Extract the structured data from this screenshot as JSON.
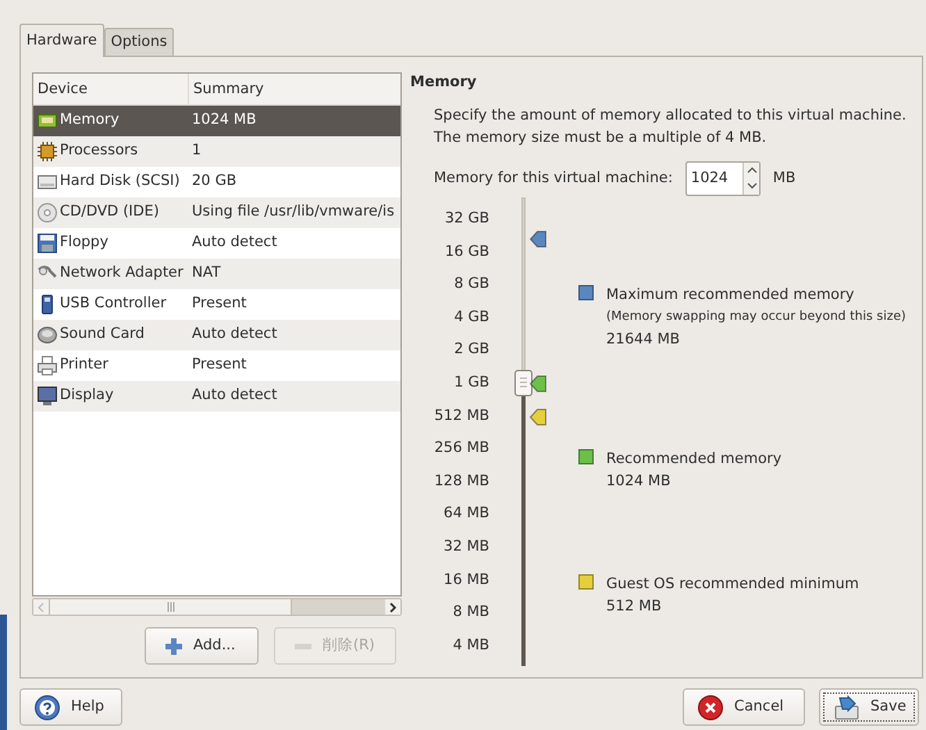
{
  "tabs": [
    {
      "label": "Hardware",
      "selected": true
    },
    {
      "label": "Options",
      "selected": false
    }
  ],
  "device_table": {
    "columns": [
      "Device",
      "Summary"
    ],
    "rows": [
      {
        "kind": "memory",
        "device": "Memory",
        "summary": "1024 MB",
        "selected": true
      },
      {
        "kind": "processor",
        "device": "Processors",
        "summary": "1",
        "selected": false
      },
      {
        "kind": "disk",
        "device": "Hard Disk (SCSI)",
        "summary": "20 GB",
        "selected": false
      },
      {
        "kind": "cdrom",
        "device": "CD/DVD (IDE)",
        "summary": "Using file /usr/lib/vmware/is",
        "selected": false
      },
      {
        "kind": "floppy",
        "device": "Floppy",
        "summary": "Auto detect",
        "selected": false
      },
      {
        "kind": "network",
        "device": "Network Adapter",
        "summary": "NAT",
        "selected": false
      },
      {
        "kind": "usb",
        "device": "USB Controller",
        "summary": "Present",
        "selected": false
      },
      {
        "kind": "sound",
        "device": "Sound Card",
        "summary": "Auto detect",
        "selected": false
      },
      {
        "kind": "printer",
        "device": "Printer",
        "summary": "Present",
        "selected": false
      },
      {
        "kind": "display",
        "device": "Display",
        "summary": "Auto detect",
        "selected": false
      }
    ]
  },
  "device_buttons": [
    {
      "kind": "add",
      "label": "Add...",
      "disabled": false
    },
    {
      "kind": "remove",
      "label": "削除(R)",
      "disabled": true
    }
  ],
  "memory_panel": {
    "title": "Memory",
    "description": [
      "Specify the amount of memory allocated to this virtual machine.",
      "The memory size must be a multiple of 4 MB."
    ],
    "spinner": {
      "label": "Memory for this virtual machine:",
      "value": "1024",
      "unit": "MB"
    },
    "scale": {
      "ticks": [
        "32 GB",
        "16 GB",
        "8 GB",
        "4 GB",
        "2 GB",
        "1 GB",
        "512 MB",
        "256 MB",
        "128 MB",
        "64 MB",
        "32 MB",
        "16 MB",
        "8 MB",
        "4 MB"
      ],
      "level": 0.615
    },
    "legend": [
      {
        "title": "Maximum recommended memory",
        "note": "(Memory swapping may occur beyond this size)",
        "value": "21644 MB",
        "color": "#5b87c0"
      },
      {
        "title": "Recommended memory",
        "value": "1024 MB",
        "color": "#6cc04a"
      },
      {
        "title": "Guest OS recommended minimum",
        "value": "512 MB",
        "color": "#e5cf3c"
      }
    ]
  },
  "dialog_buttons": [
    {
      "kind": "help",
      "label": "Help",
      "focused": false
    },
    {
      "kind": "cancel",
      "label": "Cancel",
      "focused": false
    },
    {
      "kind": "save",
      "label": "Save",
      "focused": true
    }
  ]
}
